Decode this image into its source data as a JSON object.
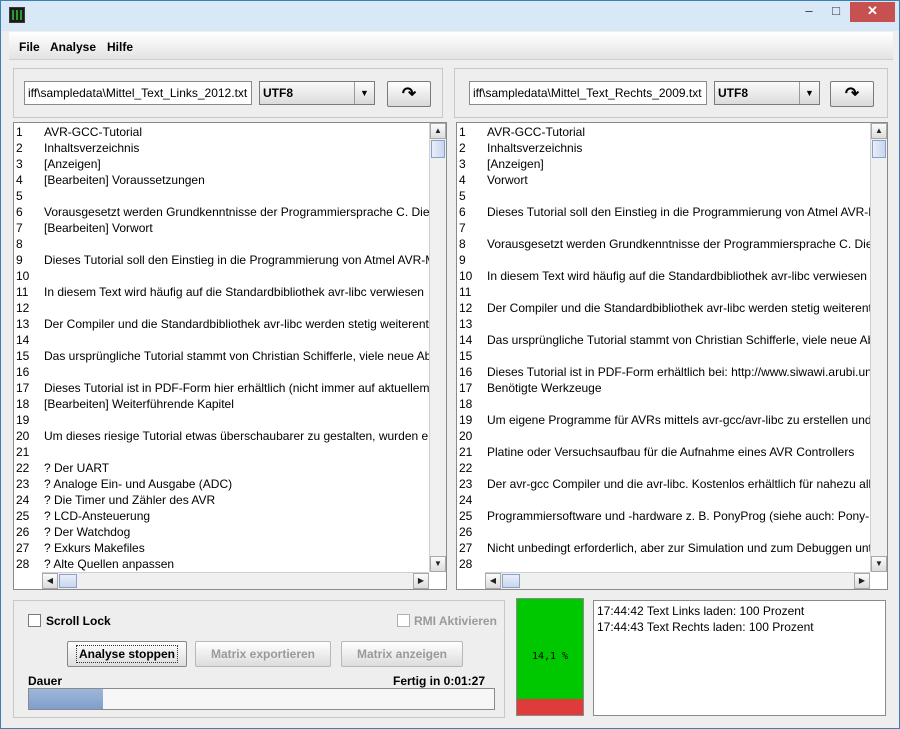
{
  "window": {
    "minimize": "–",
    "maximize": "□",
    "close": "✕"
  },
  "menu": [
    {
      "label": "File"
    },
    {
      "label": "Analyse"
    },
    {
      "label": "Hilfe"
    }
  ],
  "left": {
    "path": "iff\\sampledata\\Mittel_Text_Links_2012.txt",
    "encoding": "UTF8",
    "lines": [
      [
        "1",
        "AVR-GCC-Tutorial"
      ],
      [
        "2",
        "Inhaltsverzeichnis"
      ],
      [
        "3",
        "[Anzeigen]"
      ],
      [
        "4",
        "[Bearbeiten] Voraussetzungen"
      ],
      [
        "5",
        ""
      ],
      [
        "6",
        "Vorausgesetzt werden Grundkenntnisse der Programmiersprache C. Diese Kenntnisse kann man sich"
      ],
      [
        "7",
        "[Bearbeiten] Vorwort"
      ],
      [
        "8",
        ""
      ],
      [
        "9",
        "Dieses Tutorial soll den Einstieg in die Programmierung von Atmel AVR-Mikrocontrollern"
      ],
      [
        "10",
        ""
      ],
      [
        "11",
        "In diesem Text wird häufig auf die Standardbibliothek avr-libc verwiesen"
      ],
      [
        "12",
        ""
      ],
      [
        "13",
        "Der Compiler und die Standardbibliothek avr-libc werden stetig weiterentwickelt"
      ],
      [
        "14",
        ""
      ],
      [
        "15",
        "Das ursprüngliche Tutorial stammt von Christian Schifferle, viele neue Abschnitte"
      ],
      [
        "16",
        ""
      ],
      [
        "17",
        "Dieses Tutorial ist in PDF-Form hier erhältlich (nicht immer auf aktuellem Stand)"
      ],
      [
        "18",
        "[Bearbeiten] Weiterführende Kapitel"
      ],
      [
        "19",
        ""
      ],
      [
        "20",
        "Um dieses riesige Tutorial etwas überschaubarer zu gestalten, wurden einige Teile"
      ],
      [
        "21",
        ""
      ],
      [
        "22",
        "   ? Der UART"
      ],
      [
        "23",
        "   ? Analoge Ein- und Ausgabe (ADC)"
      ],
      [
        "24",
        "   ? Die Timer und Zähler des AVR"
      ],
      [
        "25",
        "   ? LCD-Ansteuerung"
      ],
      [
        "26",
        "   ? Der Watchdog"
      ],
      [
        "27",
        "   ? Exkurs Makefiles"
      ],
      [
        "28",
        "   ? Alte Quellen anpassen"
      ]
    ]
  },
  "right": {
    "path": "iff\\sampledata\\Mittel_Text_Rechts_2009.txt",
    "encoding": "UTF8",
    "lines": [
      [
        "1",
        "AVR-GCC-Tutorial"
      ],
      [
        "2",
        "Inhaltsverzeichnis"
      ],
      [
        "3",
        "[Anzeigen]"
      ],
      [
        "4",
        "Vorwort"
      ],
      [
        "5",
        ""
      ],
      [
        "6",
        "Dieses Tutorial soll den Einstieg in die Programmierung von Atmel AVR-Mikrocontrollern"
      ],
      [
        "7",
        ""
      ],
      [
        "8",
        "Vorausgesetzt werden Grundkenntnisse der Programmiersprache C. Diese Kenntnisse"
      ],
      [
        "9",
        ""
      ],
      [
        "10",
        "In diesem Text wird häufig auf die Standardbibliothek avr-libc verwiesen"
      ],
      [
        "11",
        ""
      ],
      [
        "12",
        "Der Compiler und die Standardbibliothek avr-libc werden stetig weiterentwickelt"
      ],
      [
        "13",
        ""
      ],
      [
        "14",
        "Das ursprüngliche Tutorial stammt von Christian Schifferle, viele neue Abschnitte"
      ],
      [
        "15",
        ""
      ],
      [
        "16",
        "Dieses Tutorial ist in PDF-Form erhältlich bei: http://www.siwawi.arubi.uni-kl.de"
      ],
      [
        "17",
        "Benötigte Werkzeuge"
      ],
      [
        "18",
        ""
      ],
      [
        "19",
        "Um eigene Programme für AVRs mittels avr-gcc/avr-libc zu erstellen und zu testen"
      ],
      [
        "20",
        ""
      ],
      [
        "21",
        "   Platine oder Versuchsaufbau für die Aufnahme eines AVR Controllers"
      ],
      [
        "22",
        ""
      ],
      [
        "23",
        "   Der avr-gcc Compiler und die avr-libc. Kostenlos erhältlich für nahezu alle Plattformen"
      ],
      [
        "24",
        ""
      ],
      [
        "25",
        "   Programmiersoftware und -hardware z. B. PonyProg (siehe auch: Pony-Prog Tutorial)"
      ],
      [
        "26",
        ""
      ],
      [
        "27",
        "   Nicht unbedingt erforderlich, aber zur Simulation und zum Debuggen unter Windows"
      ],
      [
        "28",
        ""
      ]
    ]
  },
  "controls": {
    "scroll_lock": "Scroll Lock",
    "scroll_lock_checked": false,
    "rmi": "RMI Aktivieren",
    "rmi_checked": false,
    "analyse_stop": "Analyse stoppen",
    "export_matrix": "Matrix exportieren",
    "show_matrix": "Matrix anzeigen",
    "duration_label": "Dauer",
    "finish_label": "Fertig in 0:01:27",
    "progress_fraction": 0.16
  },
  "memory": {
    "text": "14,1 %",
    "used_fraction": 0.141,
    "free_color": "#00c800",
    "used_color": "#e03b3b"
  },
  "log": [
    "17:44:42  Text Links laden: 100 Prozent",
    "17:44:43  Text Rechts laden: 100 Prozent"
  ]
}
